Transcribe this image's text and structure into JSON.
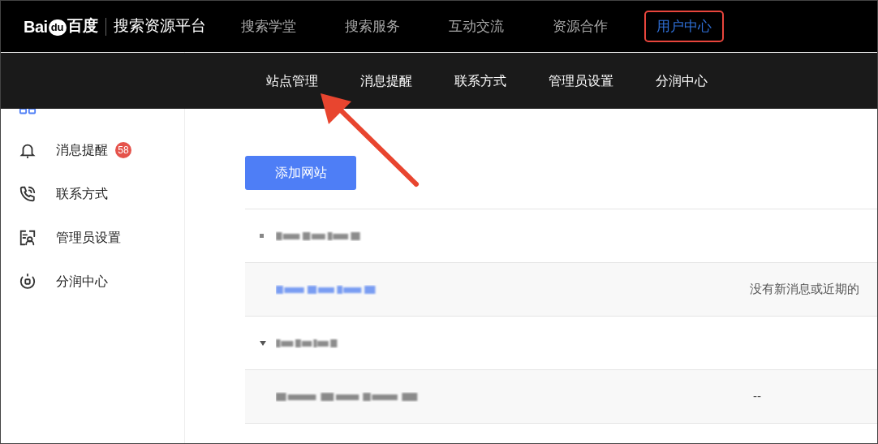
{
  "logo": {
    "parts": [
      "Bai",
      "du",
      "百度"
    ]
  },
  "platform_name": "搜索资源平台",
  "nav": [
    {
      "label": "搜索学堂",
      "selected": false,
      "highlighted": false
    },
    {
      "label": "搜索服务",
      "selected": false,
      "highlighted": false
    },
    {
      "label": "互动交流",
      "selected": false,
      "highlighted": false
    },
    {
      "label": "资源合作",
      "selected": false,
      "highlighted": false
    },
    {
      "label": "用户中心",
      "selected": true,
      "highlighted": true
    }
  ],
  "submenu": [
    "站点管理",
    "消息提醒",
    "联系方式",
    "管理员设置",
    "分润中心"
  ],
  "sidebar": {
    "items": [
      {
        "selected": true
      },
      {
        "label": "消息提醒",
        "selected": false,
        "badge": "58"
      },
      {
        "label": "联系方式",
        "selected": false
      },
      {
        "label": "管理员设置",
        "selected": false
      },
      {
        "label": "分润中心",
        "selected": false
      }
    ]
  },
  "add_button": "添加网站",
  "sites": [
    {
      "kind": "bullet_group"
    },
    {
      "kind": "site",
      "link": true,
      "status": "没有新消息或近期的"
    },
    {
      "kind": "caret_group",
      "expanded": true
    },
    {
      "kind": "site",
      "link": false,
      "status": "--"
    }
  ],
  "annotation": {
    "arrow": true
  }
}
